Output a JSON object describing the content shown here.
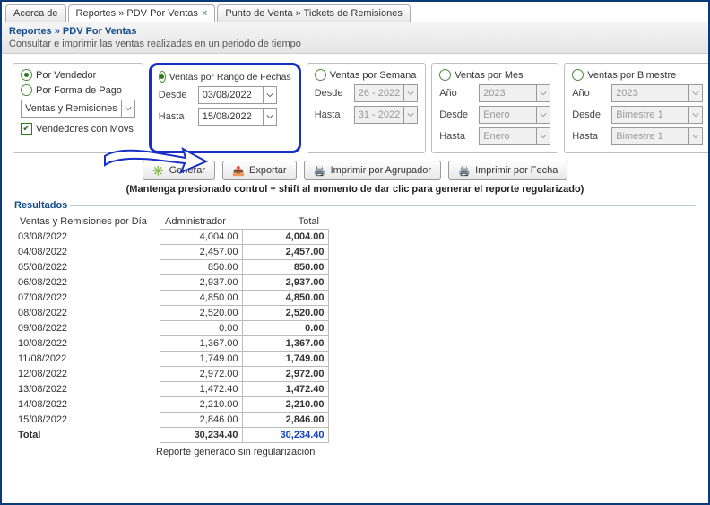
{
  "tabs": [
    {
      "label": "Acerca de"
    },
    {
      "label": "Reportes » PDV Por Ventas",
      "active": true,
      "closable": true
    },
    {
      "label": "Punto de Venta » Tickets de Remisiones"
    }
  ],
  "header": {
    "title": "Reportes » PDV Por Ventas",
    "desc": "Consultar e imprimir las ventas realizadas en un periodo de tiempo"
  },
  "filter_left": {
    "opt_vendedor": "Por Vendedor",
    "opt_forma": "Por Forma de Pago",
    "combo": "Ventas y Remisiones",
    "chk_label": "Vendedores con Movs"
  },
  "filter_fechas": {
    "title": "Ventas por Rango de Fechas",
    "desde_lab": "Desde",
    "desde_val": "03/08/2022",
    "hasta_lab": "Hasta",
    "hasta_val": "15/08/2022"
  },
  "filter_semana": {
    "title": "Ventas por Semana",
    "desde_lab": "Desde",
    "desde_val": "26 - 2022",
    "hasta_lab": "Hasta",
    "hasta_val": "31 - 2022"
  },
  "filter_mes": {
    "title": "Ventas por Mes",
    "ano_lab": "Año",
    "ano_val": "2023",
    "desde_lab": "Desde",
    "desde_val": "Enero",
    "hasta_lab": "Hasta",
    "hasta_val": "Enero"
  },
  "filter_bim": {
    "title": "Ventas por Bimestre",
    "ano_lab": "Año",
    "ano_val": "2023",
    "desde_lab": "Desde",
    "desde_val": "Bimestre 1",
    "hasta_lab": "Hasta",
    "hasta_val": "Bimestre 1"
  },
  "buttons": {
    "generar": "Generar",
    "exportar": "Exportar",
    "imp_agr": "Imprimir por Agrupador",
    "imp_fecha": "Imprimir por Fecha"
  },
  "hint": "(Mantenga presionado control + shift al momento de dar clic para generar el reporte regularizado)",
  "results_title": "Resultados",
  "columns": {
    "c0": "Ventas y Remisiones por Día",
    "c1": "Administrador",
    "c2": "Total"
  },
  "rows": [
    {
      "date": "03/08/2022",
      "adm": "4,004.00",
      "tot": "4,004.00"
    },
    {
      "date": "04/08/2022",
      "adm": "2,457.00",
      "tot": "2,457.00"
    },
    {
      "date": "05/08/2022",
      "adm": "850.00",
      "tot": "850.00"
    },
    {
      "date": "06/08/2022",
      "adm": "2,937.00",
      "tot": "2,937.00"
    },
    {
      "date": "07/08/2022",
      "adm": "4,850.00",
      "tot": "4,850.00"
    },
    {
      "date": "08/08/2022",
      "adm": "2,520.00",
      "tot": "2,520.00"
    },
    {
      "date": "09/08/2022",
      "adm": "0.00",
      "tot": "0.00"
    },
    {
      "date": "10/08/2022",
      "adm": "1,367.00",
      "tot": "1,367.00"
    },
    {
      "date": "11/08/2022",
      "adm": "1,749.00",
      "tot": "1,749.00"
    },
    {
      "date": "12/08/2022",
      "adm": "2,972.00",
      "tot": "2,972.00"
    },
    {
      "date": "13/08/2022",
      "adm": "1,472.40",
      "tot": "1,472.40"
    },
    {
      "date": "14/08/2022",
      "adm": "2,210.00",
      "tot": "2,210.00"
    },
    {
      "date": "15/08/2022",
      "adm": "2,846.00",
      "tot": "2,846.00"
    }
  ],
  "total_row": {
    "label": "Total",
    "adm": "30,234.40",
    "tot": "30,234.40"
  },
  "footer": "Reporte generado sin regularización"
}
